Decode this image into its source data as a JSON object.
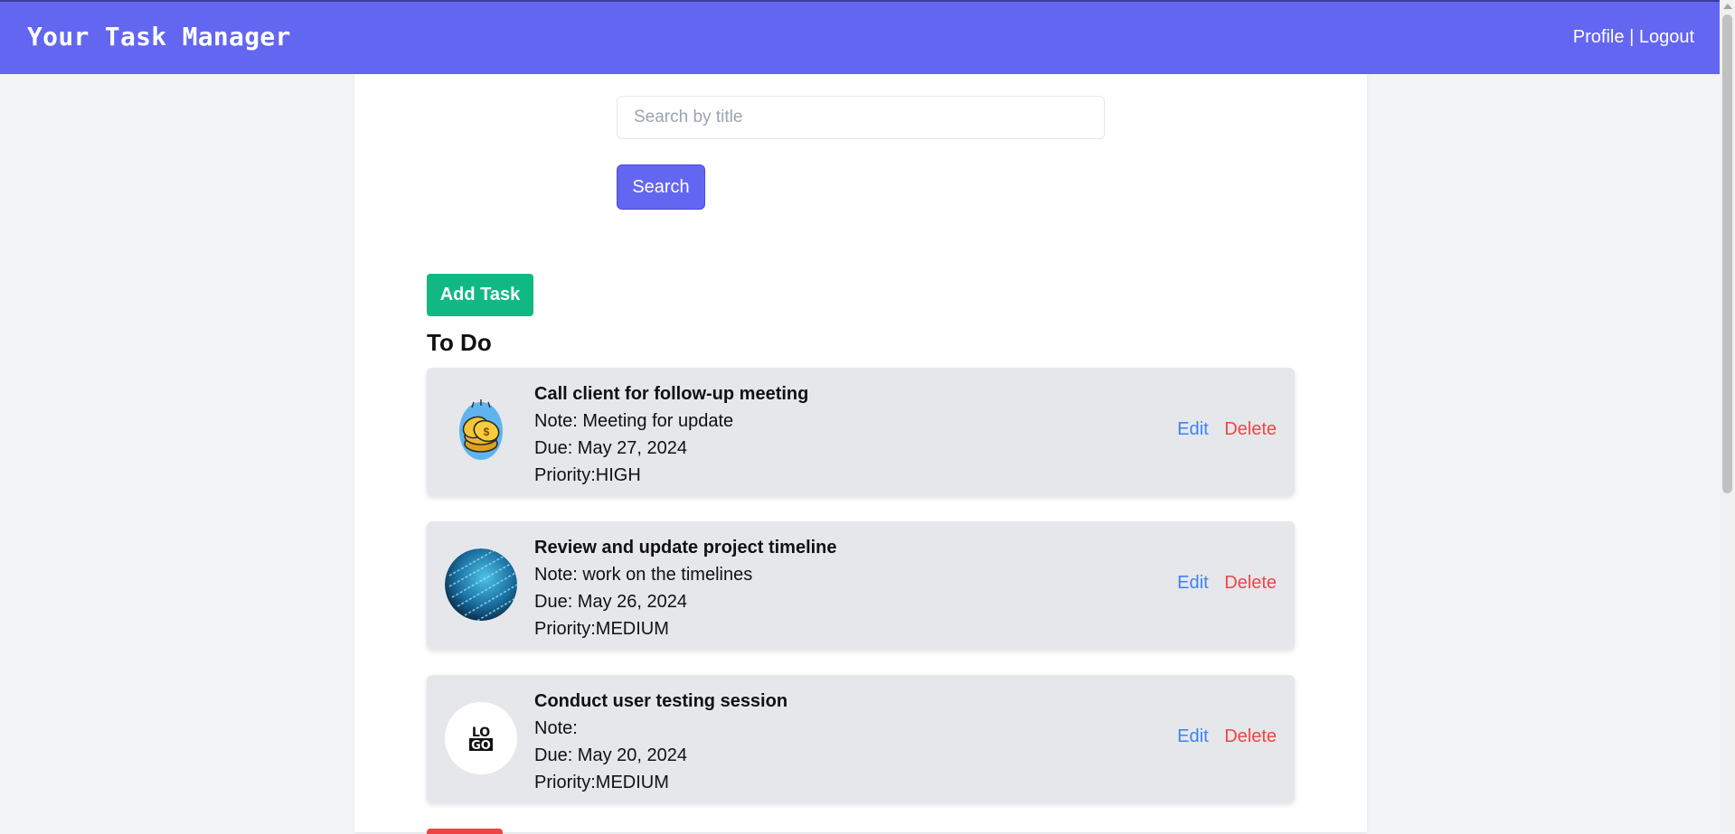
{
  "header": {
    "title": "Your Task Manager",
    "profile_label": "Profile",
    "separator": "|",
    "logout_label": "Logout"
  },
  "search": {
    "placeholder": "Search by title",
    "value": "",
    "button_label": "Search"
  },
  "add_task_label": "Add Task",
  "section_title": "To Do",
  "tasks": [
    {
      "title": "Call client for follow-up meeting",
      "note": "Note: Meeting for update",
      "due": "Due: May 27, 2024",
      "priority": "Priority:HIGH",
      "thumbnail_icon": "coins-icon",
      "edit_label": "Edit",
      "delete_label": "Delete"
    },
    {
      "title": "Review and update project timeline",
      "note": "Note: work on the timelines",
      "due": "Due: May 26, 2024",
      "priority": "Priority:MEDIUM",
      "thumbnail_icon": "code-screen-icon",
      "edit_label": "Edit",
      "delete_label": "Delete"
    },
    {
      "title": "Conduct user testing session",
      "note": "Note:",
      "due": "Due: May 20, 2024",
      "priority": "Priority:MEDIUM",
      "thumbnail_icon": "logo-badge-icon",
      "logo_text": "LOGO",
      "edit_label": "Edit",
      "delete_label": "Delete"
    }
  ],
  "colors": {
    "header": "#6366f1",
    "search_button": "#6366f1",
    "add_button": "#10b981",
    "edit_link": "#3b82f6",
    "delete_link": "#ef4444",
    "card": "#e5e7eb"
  }
}
